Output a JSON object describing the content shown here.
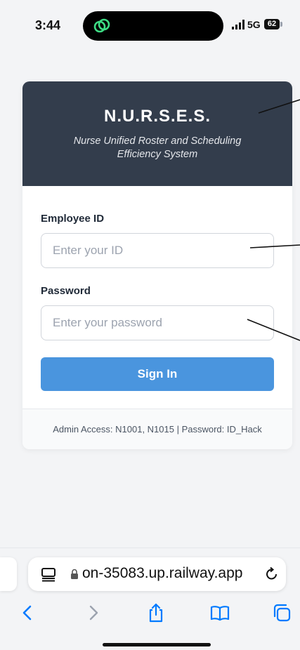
{
  "status_bar": {
    "time": "3:44",
    "network": "5G",
    "battery": "62"
  },
  "login": {
    "title": "N.U.R.S.E.S.",
    "subtitle": "Nurse Unified Roster and Scheduling Efficiency System",
    "employee_id_label": "Employee ID",
    "employee_id_placeholder": "Enter your ID",
    "employee_id_value": "",
    "password_label": "Password",
    "password_placeholder": "Enter your password",
    "password_value": "",
    "sign_in_label": "Sign In",
    "footer_note": "Admin Access: N1001, N1015 | Password: ID_Hack"
  },
  "browser": {
    "url": "on-35083.up.railway.app"
  },
  "colors": {
    "header_bg": "#333d4c",
    "accent": "#4a95de",
    "page_bg": "#f3f4f6",
    "ios_blue": "#007aff",
    "island_icon_green": "#3ddc84"
  },
  "icons": {
    "island": "green-link-icon",
    "signal": "signal-bars-icon",
    "tabs": "tab-overview-icon",
    "lock": "lock-icon",
    "reload": "reload-icon",
    "back": "chevron-left-icon",
    "forward": "chevron-right-icon",
    "share": "share-icon",
    "bookmarks": "book-icon",
    "all_tabs": "tabs-icon"
  }
}
